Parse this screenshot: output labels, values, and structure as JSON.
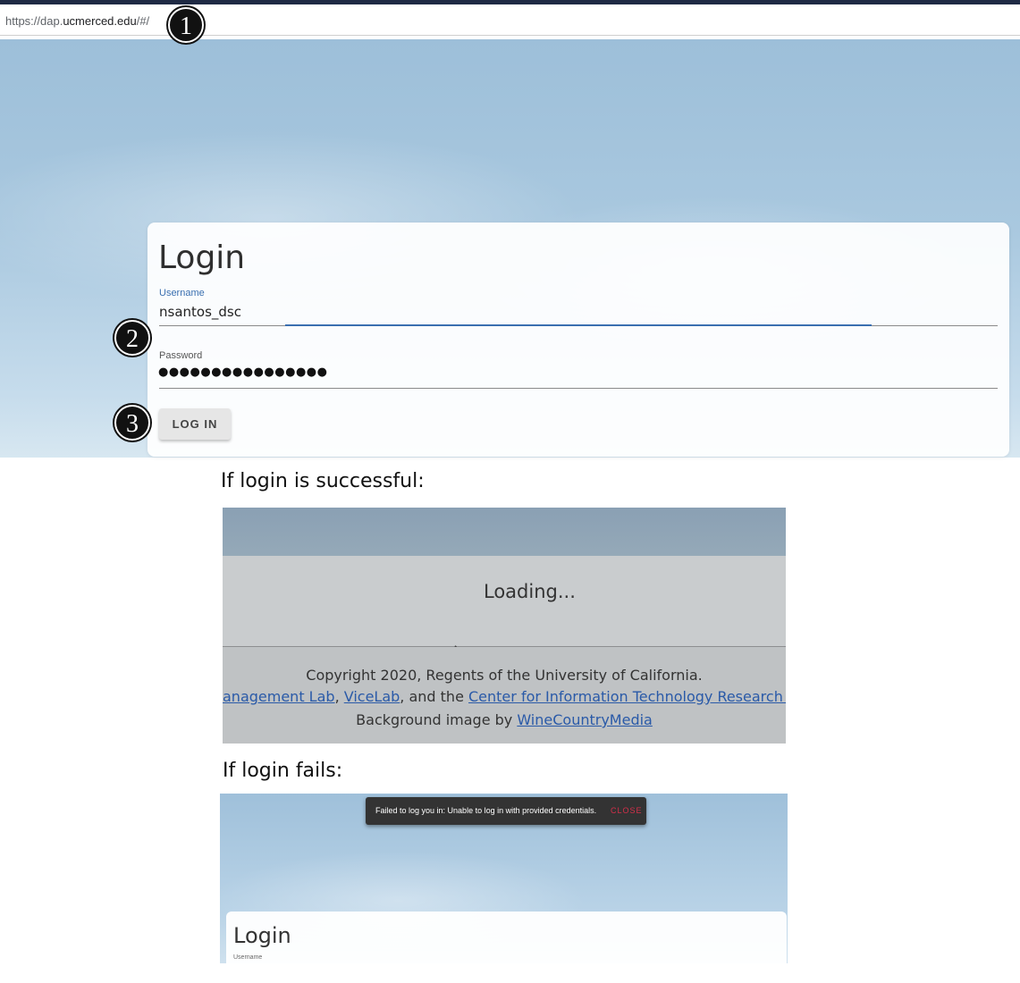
{
  "browser": {
    "url_prefix": "https://dap.",
    "url_host": "ucmerced.edu",
    "url_suffix": "/#/"
  },
  "steps": [
    "1",
    "2",
    "3"
  ],
  "login_form": {
    "title": "Login",
    "username_label": "Username",
    "username_value": "nsantos_dsc",
    "password_label": "Password",
    "password_value": "●●●●●●●●●●●●●●●●",
    "button_label": "LOG IN"
  },
  "success": {
    "caption": "If login is successful:",
    "loading_text": "Loading...",
    "copyright": "Copyright 2020, Regents of the University of California.",
    "credits_link1": "anagement Lab",
    "credits_sep1": ", ",
    "credits_link2": "ViceLab",
    "credits_sep2": ", and the ",
    "credits_link3": "Center for Information Technology Research in the Inte",
    "bg_prefix": "Background image by ",
    "bg_link": "WineCountryMedia"
  },
  "failure": {
    "caption": "If login fails:",
    "toast_message": "Failed to log you in: Unable to log in with provided credentials.",
    "toast_close": "CLOSE",
    "login_title": "Login",
    "username_label": "Username"
  },
  "colors": {
    "accent": "#3a6fb0",
    "link": "#2a5aa8",
    "toast_close": "#d32f4a"
  }
}
